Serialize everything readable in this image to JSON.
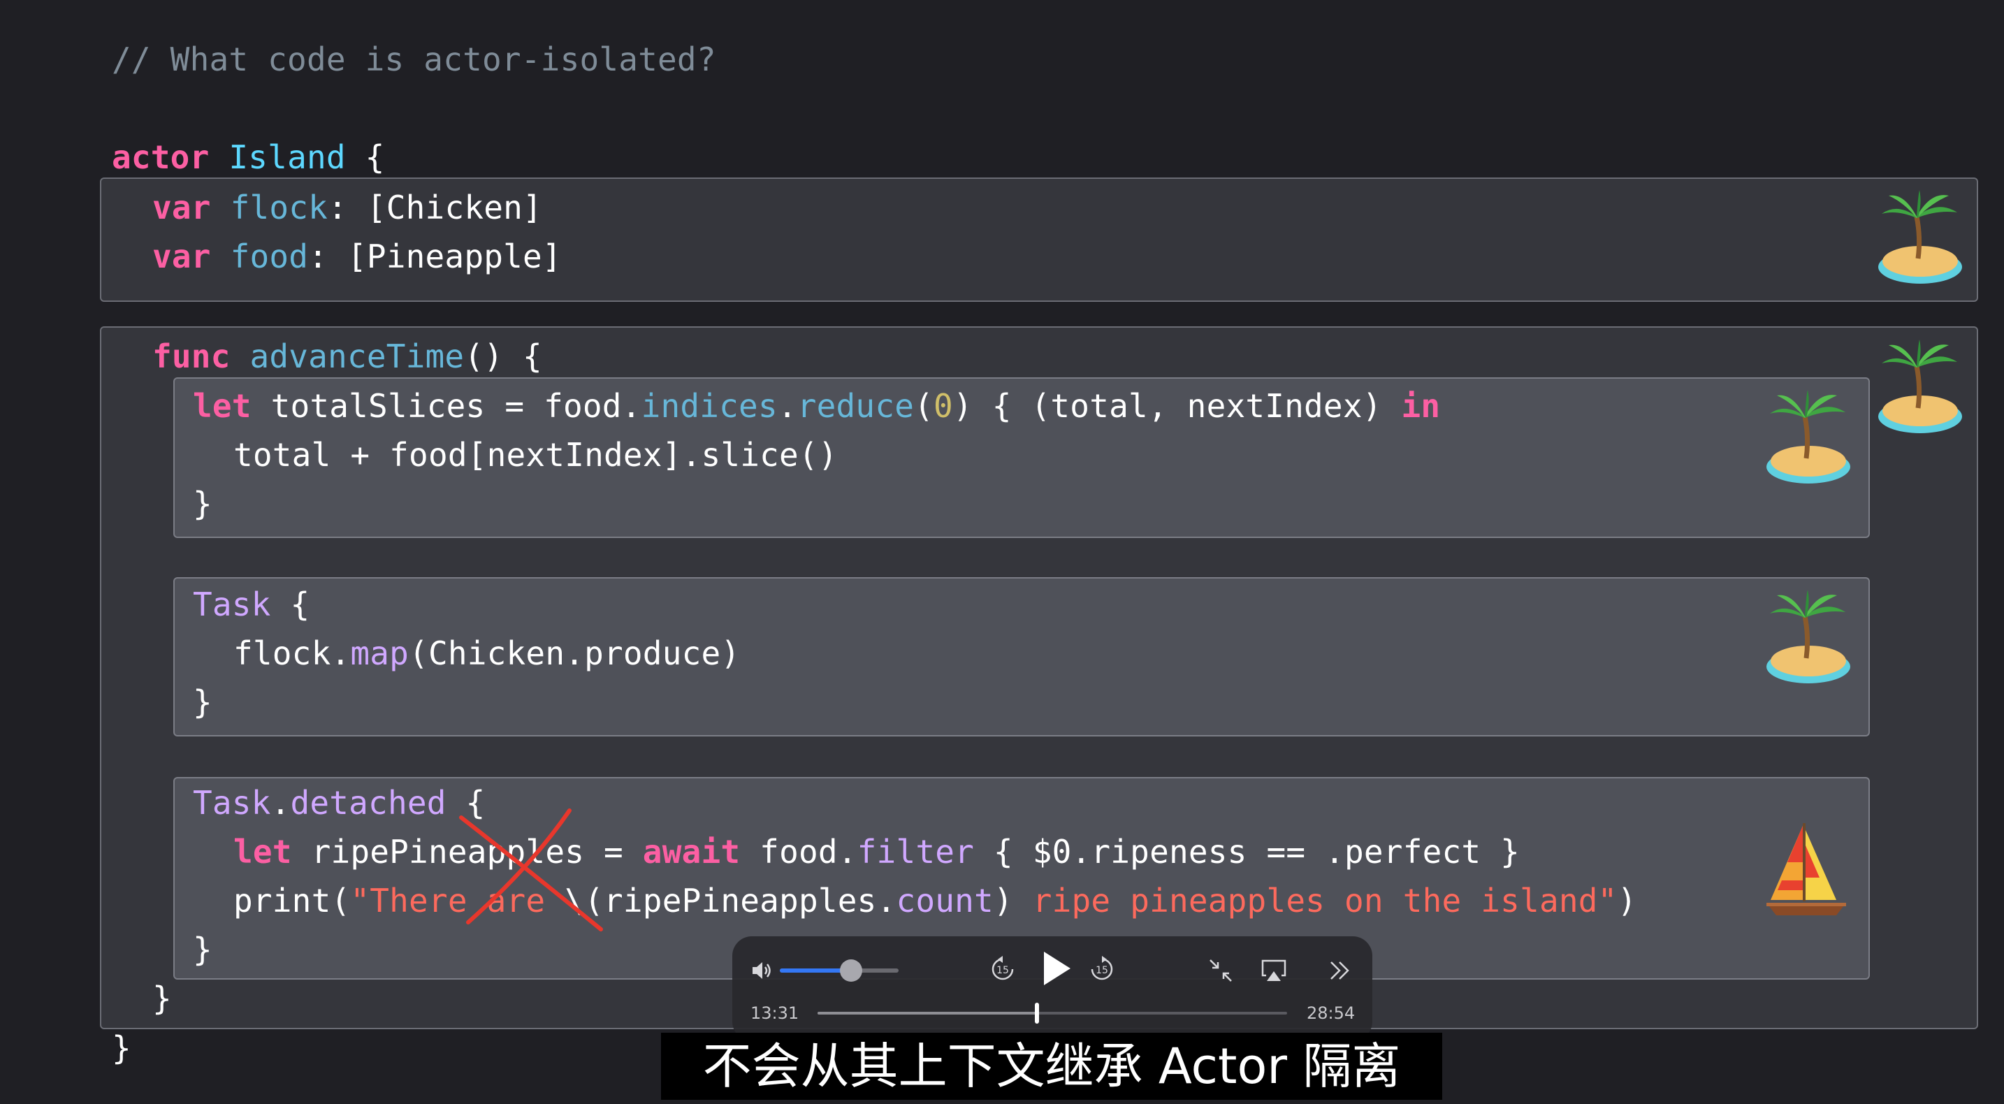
{
  "code": {
    "comment": "// What code is actor-isolated?",
    "actor_kw": "actor",
    "actor_name": "Island",
    "brace_open": " {",
    "var1": {
      "kw": "var",
      "name": "flock",
      "rest": ": [Chicken]"
    },
    "var2": {
      "kw": "var",
      "name": "food",
      "rest": ": [Pineapple]"
    },
    "func": {
      "kw": "func",
      "name": "advanceTime",
      "rest": "() {"
    },
    "block1": {
      "l1_kw": "let",
      "l1_a": " totalSlices = food.",
      "l1_indices": "indices",
      "l1_dot": ".",
      "l1_reduce": "reduce",
      "l1_p": "(",
      "l1_zero": "0",
      "l1_b": ") { (total, nextIndex) ",
      "l1_in": "in",
      "l2": "total + food[nextIndex].slice()",
      "l3": "}"
    },
    "block2": {
      "l1_task": "Task",
      "l1_b": " {",
      "l2_a": "flock.",
      "l2_map": "map",
      "l2_b": "(Chicken.produce)",
      "l3": "}"
    },
    "block3": {
      "l1_task": "Task",
      "l1_dot": ".",
      "l1_detached": "detached",
      "l1_b": " {",
      "l2_let": "let",
      "l2_a": " ripePineapples = ",
      "l2_await": "await",
      "l2_b": " food.",
      "l2_filter": "filter",
      "l2_c": " { $0.ripeness == .perfect }",
      "l3_a": "print(",
      "l3_str1": "\"There are ",
      "l3_b": "\\(ripePineapples.",
      "l3_count": "count",
      "l3_c": ") ",
      "l3_str2": "ripe pineapples on the island\"",
      "l3_d": ")",
      "l4": "}"
    },
    "func_close": "}",
    "actor_close": "}"
  },
  "player": {
    "current_time": "13:31",
    "total_time": "28:54",
    "volume_level": 0.6,
    "progress": 0.468,
    "skip_back_seconds": "15",
    "skip_forward_seconds": "15",
    "icons": [
      "volume-icon",
      "skip-back-15-icon",
      "play-icon",
      "skip-forward-15-icon",
      "exit-fullscreen-icon",
      "airplay-icon",
      "more-icon"
    ]
  },
  "subtitle": "不会从其上下文继承 Actor 隔离",
  "colors": {
    "keyword": "#fc5fa3",
    "type": "#5dd8ff",
    "property": "#67b7d9",
    "method_purple": "#d0a8ff",
    "number": "#d0bf69",
    "string": "#fc6a5d",
    "comment": "#7f8c98",
    "background": "#1f1f24"
  }
}
